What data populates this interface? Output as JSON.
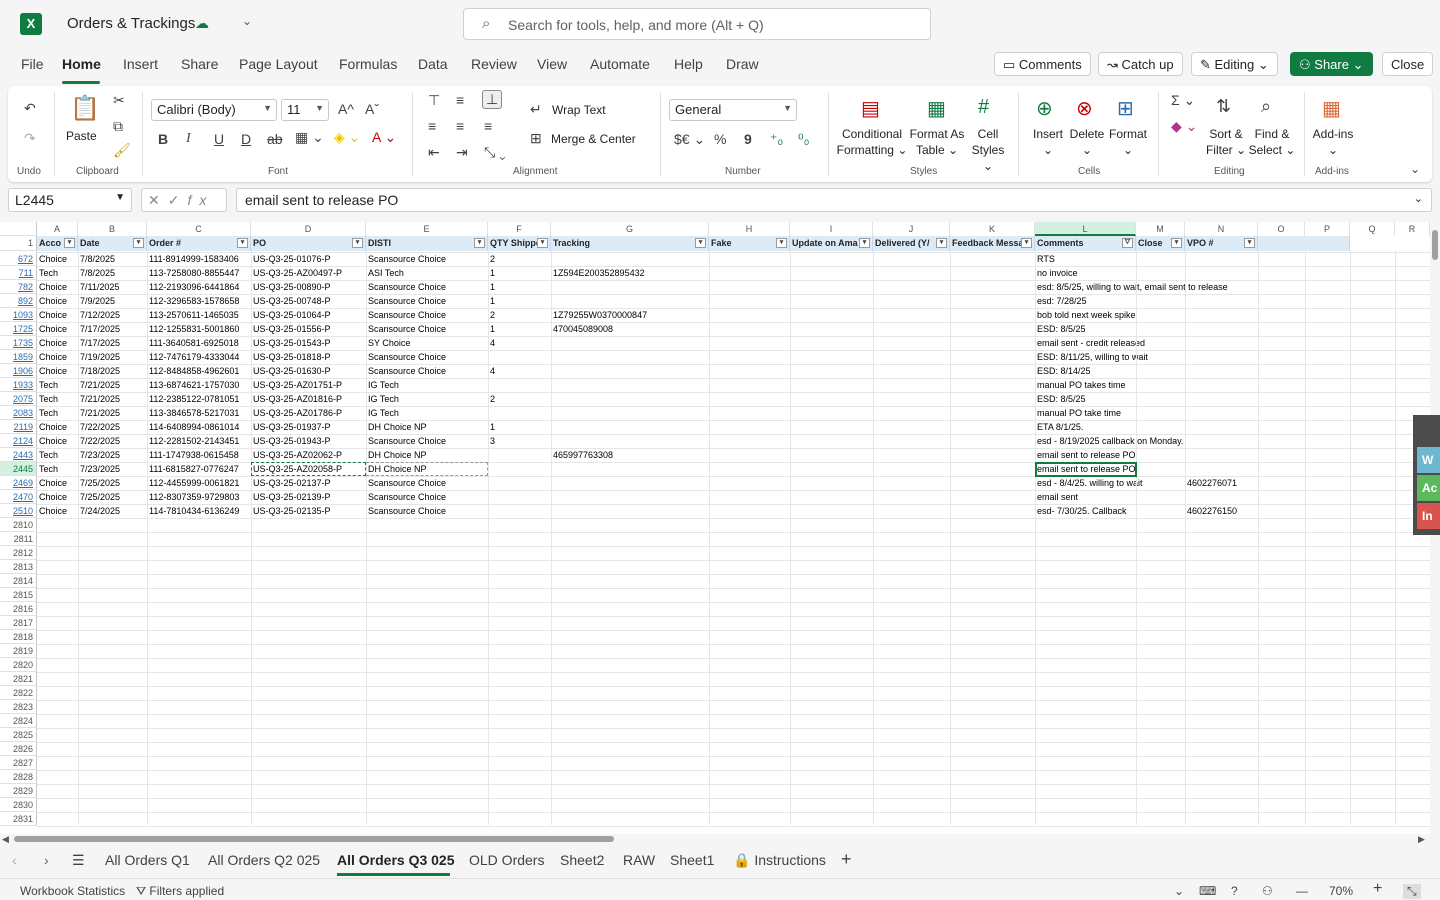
{
  "app": {
    "logo_letter": "X",
    "doc_title": "Orders & Trackings",
    "search_placeholder": "Search for tools, help, and more (Alt + Q)"
  },
  "menu": [
    "File",
    "Home",
    "Insert",
    "Share",
    "Page Layout",
    "Formulas",
    "Data",
    "Review",
    "View",
    "Automate",
    "Help",
    "Draw"
  ],
  "active_menu": "Home",
  "top_buttons": {
    "comments": "Comments",
    "catchup": "Catch up",
    "editing": "Editing",
    "share": "Share",
    "close": "Close"
  },
  "ribbon": {
    "groups": {
      "undo": "Undo",
      "clipboard": "Clipboard",
      "font": "Font",
      "alignment": "Alignment",
      "number": "Number",
      "styles": "Styles",
      "cells": "Cells",
      "editing": "Editing",
      "addins": "Add-ins"
    },
    "paste": "Paste",
    "font_name": "Calibri (Body)",
    "font_size": "11",
    "wrap_text": "Wrap Text",
    "merge_center": "Merge & Center",
    "number_format": "General",
    "conditional": "Conditional",
    "formatting": "Formatting",
    "format_as": "Format As",
    "table": "Table",
    "cell": "Cell",
    "styles_lbl": "Styles",
    "insert": "Insert",
    "delete": "Delete",
    "format": "Format",
    "sort": "Sort &",
    "filter": "Filter",
    "find": "Find &",
    "select": "Select",
    "addins": "Add-ins",
    "bold": "B",
    "italic": "I",
    "underline": "U",
    "strike": "ab",
    "currency": "$€",
    "percent": "%",
    "comma": "9",
    "sigma": "Σ"
  },
  "formula_bar": {
    "name_box": "L2445",
    "formula": "email sent to release PO",
    "fx": "fx"
  },
  "columns": [
    "A",
    "B",
    "C",
    "D",
    "E",
    "F",
    "G",
    "H",
    "I",
    "J",
    "K",
    "L",
    "M",
    "N",
    "O",
    "P",
    "Q",
    "R"
  ],
  "selected_column": "L",
  "headers": [
    "Acco",
    "Date",
    "Order #",
    "PO",
    "DISTI",
    "QTY Shippe",
    "Tracking",
    "Fake",
    "Update on Ama",
    "Delivered (Y/",
    "Feedback Messa",
    "Comments",
    "Close",
    "VPO #"
  ],
  "rows": [
    {
      "n": "672",
      "a": "Choice",
      "b": "7/8/2025",
      "c": "111-8914999-1583406",
      "d": "US-Q3-25-01076-P",
      "e": "Scansource Choice",
      "f": "2",
      "g": "",
      "l": "RTS",
      "n2": ""
    },
    {
      "n": "711",
      "a": "Tech",
      "b": "7/8/2025",
      "c": "113-7258080-8855447",
      "d": "US-Q3-25-AZ00497-P",
      "e": "ASI Tech",
      "f": "1",
      "g": "1Z594E200352895432",
      "l": "no invoice",
      "n2": ""
    },
    {
      "n": "782",
      "a": "Choice",
      "b": "7/11/2025",
      "c": "112-2193096-6441864",
      "d": "US-Q3-25-00890-P",
      "e": "Scansource Choice",
      "f": "1",
      "g": "",
      "l": "esd: 8/5/25, willing to wait, email sent to release",
      "n2": ""
    },
    {
      "n": "892",
      "a": "Choice",
      "b": "7/9/2025",
      "c": "112-3296583-1578658",
      "d": "US-Q3-25-00748-P",
      "e": "Scansource Choice",
      "f": "1",
      "g": "",
      "l": "esd: 7/28/25",
      "n2": ""
    },
    {
      "n": "1093",
      "a": "Choice",
      "b": "7/12/2025",
      "c": "113-2570611-1465035",
      "d": "US-Q3-25-01064-P",
      "e": "Scansource Choice",
      "f": "2",
      "g": "1Z79255W0370000847",
      "l": "bob told next week spike",
      "n2": ""
    },
    {
      "n": "1725",
      "a": "Choice",
      "b": "7/17/2025",
      "c": "112-1255831-5001860",
      "d": "US-Q3-25-01556-P",
      "e": "Scansource Choice",
      "f": "1",
      "g": "470045089008",
      "l": " ESD:  8/5/25",
      "n2": ""
    },
    {
      "n": "1735",
      "a": "Choice",
      "b": "7/17/2025",
      "c": "111-3640581-6925018",
      "d": "US-Q3-25-01543-P",
      "e": "SY Choice",
      "f": "4",
      "g": "",
      "l": "email sent - credit released",
      "n2": ""
    },
    {
      "n": "1859",
      "a": "Choice",
      "b": "7/19/2025",
      "c": "112-7476179-4333044",
      "d": "US-Q3-25-01818-P",
      "e": "Scansource Choice",
      "f": "",
      "g": "",
      "l": "ESD: 8/11/25, willing to wait",
      "n2": ""
    },
    {
      "n": "1906",
      "a": "Choice",
      "b": "7/18/2025",
      "c": "112-8484858-4962601",
      "d": "US-Q3-25-01630-P",
      "e": "Scansource Choice",
      "f": "4",
      "g": "",
      "l": "ESD: 8/14/25",
      "n2": ""
    },
    {
      "n": "1933",
      "a": "Tech",
      "b": "7/21/2025",
      "c": "113-6874621-1757030",
      "d": "US-Q3-25-AZ01751-P",
      "e": "IG Tech",
      "f": "",
      "g": "",
      "l": "manual PO takes time",
      "n2": ""
    },
    {
      "n": "2075",
      "a": "Tech",
      "b": "7/21/2025",
      "c": "112-2385122-0781051",
      "d": "US-Q3-25-AZ01816-P",
      "e": "IG Tech",
      "f": "2",
      "g": "",
      "l": " ESD:  8/5/25",
      "n2": ""
    },
    {
      "n": "2083",
      "a": "Tech",
      "b": "7/21/2025",
      "c": "113-3846578-5217031",
      "d": "US-Q3-25-AZ01786-P",
      "e": "IG Tech",
      "f": "",
      "g": "",
      "l": "manual PO take time",
      "n2": ""
    },
    {
      "n": "2119",
      "a": "Choice",
      "b": "7/22/2025",
      "c": "114-6408994-0861014",
      "d": "US-Q3-25-01937-P",
      "e": "DH Choice NP",
      "f": "1",
      "g": "",
      "l": "ETA 8/1/25.",
      "n2": ""
    },
    {
      "n": "2124",
      "a": "Choice",
      "b": "7/22/2025",
      "c": "112-2281502-2143451",
      "d": "US-Q3-25-01943-P",
      "e": "Scansource Choice",
      "f": "3",
      "g": "",
      "l": "esd - 8/19/2025 callback on Monday.",
      "n2": ""
    },
    {
      "n": "2443",
      "a": "Tech",
      "b": "7/23/2025",
      "c": "111-1747938-0615458",
      "d": "US-Q3-25-AZ02062-P",
      "e": "DH Choice NP",
      "f": "",
      "g": "465997763308",
      "l": "email sent to release PO",
      "n2": ""
    },
    {
      "n": "2445",
      "a": "Tech",
      "b": "7/23/2025",
      "c": "111-6815827-0776247",
      "d": "US-Q3-25-AZ02058-P",
      "e": "DH Choice NP",
      "f": "",
      "g": "",
      "l": "email sent to release PO",
      "n2": ""
    },
    {
      "n": "2469",
      "a": "Choice",
      "b": "7/25/2025",
      "c": "112-4455999-0061821",
      "d": "US-Q3-25-02137-P",
      "e": "Scansource Choice",
      "f": "",
      "g": "",
      "l": "esd -  8/4/25. willing to wait",
      "n2": "4602276071"
    },
    {
      "n": "2470",
      "a": "Choice",
      "b": "7/25/2025",
      "c": "112-8307359-9729803",
      "d": "US-Q3-25-02139-P",
      "e": "Scansource Choice",
      "f": "",
      "g": "",
      "l": "email sent",
      "n2": ""
    },
    {
      "n": "2510",
      "a": "Choice",
      "b": "7/24/2025",
      "c": "114-7810434-6136249",
      "d": "US-Q3-25-02135-P",
      "e": "Scansource Choice",
      "f": "",
      "g": "",
      "l": "esd- 7/30/25. Callback",
      "n2": "4602276150"
    }
  ],
  "empty_rows": [
    "2810",
    "2811",
    "2812",
    "2813",
    "2814",
    "2815",
    "2816",
    "2817",
    "2818",
    "2819",
    "2820",
    "2821",
    "2822",
    "2823",
    "2824",
    "2825",
    "2826",
    "2827",
    "2828",
    "2829",
    "2830",
    "2831"
  ],
  "header_row_number": "1",
  "sheets": [
    "All Orders Q1",
    "All Orders Q2 025",
    "All Orders Q3 025",
    "OLD Orders",
    "Sheet2",
    "RAW",
    "Sheet1",
    "Instructions"
  ],
  "active_sheet": "All Orders Q3 025",
  "status": {
    "workbook_stats": "Workbook Statistics",
    "filters": "Filters applied",
    "zoom": "70%"
  },
  "side_panel": [
    "W",
    "Ac",
    "In"
  ],
  "colors": {
    "brand": "#107c41",
    "header_fill": "#ddebf7"
  }
}
